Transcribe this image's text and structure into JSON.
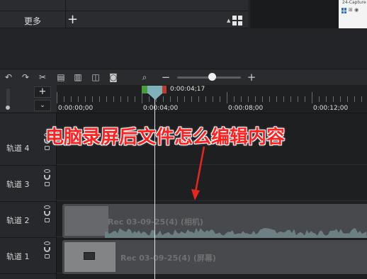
{
  "top": {
    "more_label": "更多",
    "add_symbol": "+",
    "thumb_title": "24-Capture"
  },
  "toolbar": {
    "icons": [
      "undo-icon",
      "redo-icon",
      "cut-icon",
      "copy-icon",
      "paste-icon",
      "split-icon",
      "snapshot-icon",
      "zoom-icon"
    ],
    "zoom_out": "−",
    "zoom_in": "+",
    "zoom_level": 0.55
  },
  "track_controls": {
    "add": "+",
    "collapse": "⌄"
  },
  "ruler": {
    "playhead_time": "0:00:04;17",
    "ticks": [
      "0:00:00;00",
      "0:00:04;00",
      "0:00:08;00",
      "0:00:12;00"
    ]
  },
  "tracks": [
    {
      "name": "轨道 4"
    },
    {
      "name": "轨道 3"
    },
    {
      "name": "轨道 2"
    },
    {
      "name": "轨道 1"
    }
  ],
  "clips": {
    "track2": "Rec 03-09-25(4) (相机)",
    "track1": "Rec 03-09-25(4) (屏幕)"
  },
  "overlay": {
    "title": "电脑录屏后文件怎么编辑内容"
  },
  "colors": {
    "overlay_text": "#ff2020",
    "playhead": "#7fb1ba",
    "selection_start": "#4a9d3b",
    "selection_end": "#c0392b"
  }
}
